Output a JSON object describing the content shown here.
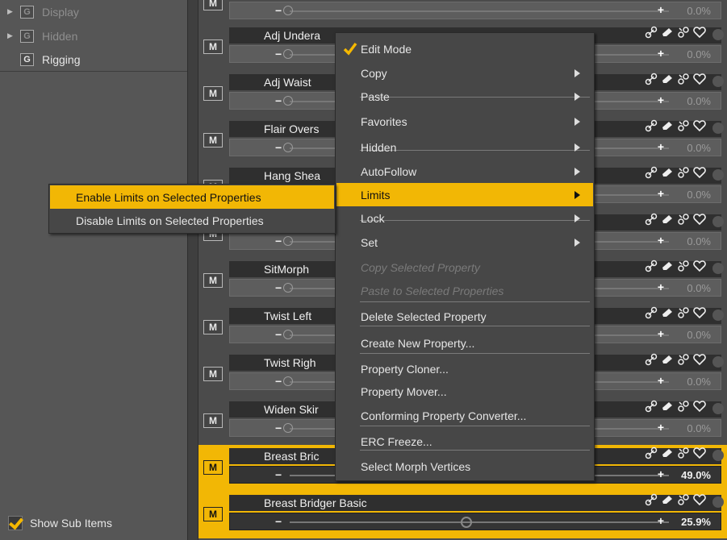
{
  "tree": {
    "items": [
      {
        "label": "Display",
        "badge": "G",
        "expandable": true,
        "dim": true
      },
      {
        "label": "Hidden",
        "badge": "G",
        "expandable": true,
        "dim": true
      },
      {
        "label": "Rigging",
        "badge": "G",
        "expandable": false,
        "dim": false
      }
    ],
    "show_sub_items_label": "Show Sub Items"
  },
  "properties": [
    {
      "name": "",
      "value": "0.0%",
      "modifier": "M"
    },
    {
      "name": "Adj Undera",
      "value": "0.0%",
      "modifier": "M"
    },
    {
      "name": "Adj Waist",
      "value": "0.0%",
      "modifier": "M"
    },
    {
      "name": "Flair Overs",
      "value": "0.0%",
      "modifier": "M"
    },
    {
      "name": "Hang Shea",
      "value": "0.0%",
      "modifier": "M"
    },
    {
      "name": "",
      "value": "0.0%",
      "modifier": "M"
    },
    {
      "name": "SitMorph",
      "value": "0.0%",
      "modifier": "M"
    },
    {
      "name": "Twist Left",
      "value": "0.0%",
      "modifier": "M"
    },
    {
      "name": "Twist Righ",
      "value": "0.0%",
      "modifier": "M"
    },
    {
      "name": "Widen Skir",
      "value": "0.0%",
      "modifier": "M"
    },
    {
      "name": "Breast Bric",
      "value": "49.0%",
      "modifier": "M",
      "selected": true
    },
    {
      "name": "Breast Bridger Basic",
      "value": "25.9%",
      "modifier": "M",
      "selected": true
    }
  ],
  "context_menu": {
    "items": [
      {
        "label": "Edit Mode",
        "checked": true
      },
      {
        "label": "Copy",
        "submenu": true
      },
      {
        "label": "Paste",
        "submenu": true
      },
      {
        "label": "Favorites",
        "submenu": true
      },
      {
        "label": "Hidden",
        "submenu": true
      },
      {
        "label": "AutoFollow",
        "submenu": true
      },
      {
        "label": "Limits",
        "submenu": true,
        "highlighted": true
      },
      {
        "label": "Lock",
        "submenu": true
      },
      {
        "label": "Set",
        "submenu": true
      },
      {
        "label": "Copy Selected Property",
        "disabled": true
      },
      {
        "label": "Paste to Selected Properties",
        "disabled": true
      },
      {
        "label": "Delete Selected Property"
      },
      {
        "label": "Create New Property..."
      },
      {
        "label": "Property Cloner..."
      },
      {
        "label": "Property Mover..."
      },
      {
        "label": "Conforming Property Converter..."
      },
      {
        "label": "ERC Freeze..."
      },
      {
        "label": "Select Morph Vertices"
      }
    ]
  },
  "limits_submenu": {
    "items": [
      {
        "label": "Enable Limits on Selected Properties",
        "highlighted": true
      },
      {
        "label": "Disable Limits on Selected Properties"
      }
    ]
  },
  "colors": {
    "accent": "#f2b705",
    "panel": "#565656",
    "menu": "#474747"
  },
  "icons": [
    "link-icon",
    "eraser-icon",
    "unlink-icon",
    "heart-icon",
    "gear-icon",
    "submenu-arrow-icon",
    "expand-arrow-icon",
    "checkmark-icon"
  ]
}
